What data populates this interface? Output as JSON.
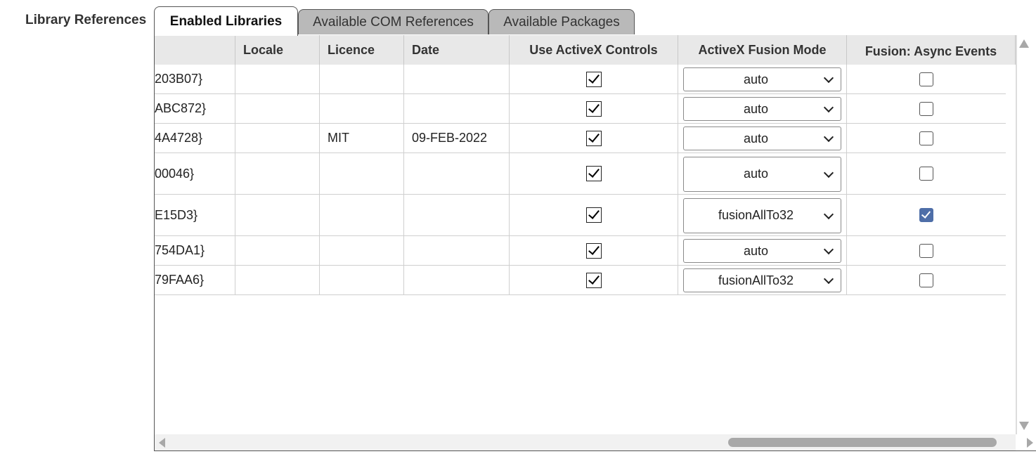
{
  "section_label": "Library References",
  "tabs": [
    {
      "label": "Enabled Libraries",
      "active": true
    },
    {
      "label": "Available COM References",
      "active": false
    },
    {
      "label": "Available Packages",
      "active": false
    }
  ],
  "columns": {
    "guid": "",
    "locale": "Locale",
    "licence": "Licence",
    "date": "Date",
    "activex": "Use ActiveX Controls",
    "fusion_mode": "ActiveX Fusion Mode",
    "async": "Fusion: Async Events"
  },
  "rows": [
    {
      "guid": "203B07}",
      "locale": "",
      "licence": "",
      "date": "",
      "activex": true,
      "fusion_mode": "auto",
      "async": false
    },
    {
      "guid": "ABC872}",
      "locale": "",
      "licence": "",
      "date": "",
      "activex": true,
      "fusion_mode": "auto",
      "async": false
    },
    {
      "guid": "4A4728}",
      "locale": "",
      "licence": "MIT",
      "date": "09-FEB-2022",
      "activex": true,
      "fusion_mode": "auto",
      "async": false
    },
    {
      "guid": "00046}",
      "locale": "",
      "licence": "",
      "date": "",
      "activex": true,
      "fusion_mode": "auto",
      "async": false
    },
    {
      "guid": "E15D3}",
      "locale": "",
      "licence": "",
      "date": "",
      "activex": true,
      "fusion_mode": "fusionAllTo32",
      "async": true
    },
    {
      "guid": "754DA1}",
      "locale": "",
      "licence": "",
      "date": "",
      "activex": true,
      "fusion_mode": "auto",
      "async": false
    },
    {
      "guid": "79FAA6}",
      "locale": "",
      "licence": "",
      "date": "",
      "activex": true,
      "fusion_mode": "fusionAllTo32",
      "async": false
    }
  ],
  "colors": {
    "checked_box": "#4e6ea8",
    "inactive_tab": "#b9b9b9",
    "header_bg": "#e8e8e8"
  }
}
